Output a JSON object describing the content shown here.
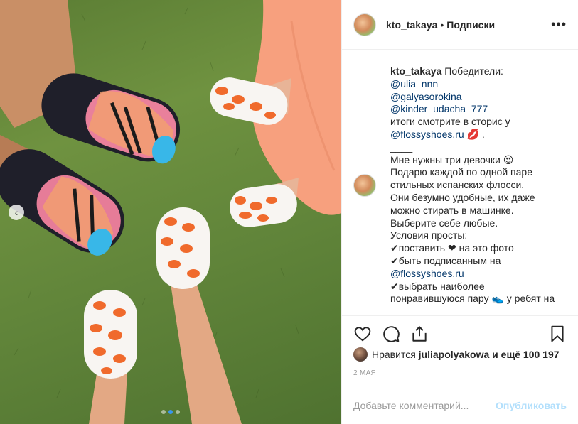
{
  "post": {
    "author": "kto_takaya",
    "separator": "•",
    "follow_label": "Подписки",
    "more_glyph": "•••"
  },
  "caption": {
    "author": "kto_takaya",
    "intro": "Победители:",
    "winners": [
      "@ulia_nnn",
      "@galyasorokina",
      "@kinder_udacha_777"
    ],
    "results_line": "итоги смотрите в сторис у",
    "brand_link": "@flossyshoes.ru",
    "kiss_emoji": "💋",
    "period": " .",
    "divider": "____",
    "lines": [
      "Мне нужны три девочки 😍",
      "Подарю каждой по одной паре",
      "стильных испанских флосси.",
      "Они безумно удобные, их даже",
      "можно стирать в машинке.",
      "Выберите себе любые.",
      "Условия просты:",
      "✔поставить ❤ на это фото",
      "✔быть подписанным на"
    ],
    "brand_link_2": "@flossyshoes.ru",
    "tail_lines": [
      "✔выбрать наиболее",
      "понравившуюся пару 👟 у ребят на"
    ]
  },
  "likes": {
    "prefix": "Нравится",
    "liker": "juliapolyakowa",
    "suffix": "и ещё 100 197"
  },
  "date": "2 МАЯ",
  "comment": {
    "placeholder": "Добавьте комментарий...",
    "publish_label": "Опубликовать"
  },
  "icons": {
    "carousel_prev": "‹",
    "like": "heart-icon",
    "comment": "comment-icon",
    "share": "share-icon",
    "save": "bookmark-icon"
  },
  "colors": {
    "link": "#003569",
    "publish_disabled": "#b2dffc",
    "carousel_dot_active": "#3897f0",
    "muted": "#999999"
  }
}
